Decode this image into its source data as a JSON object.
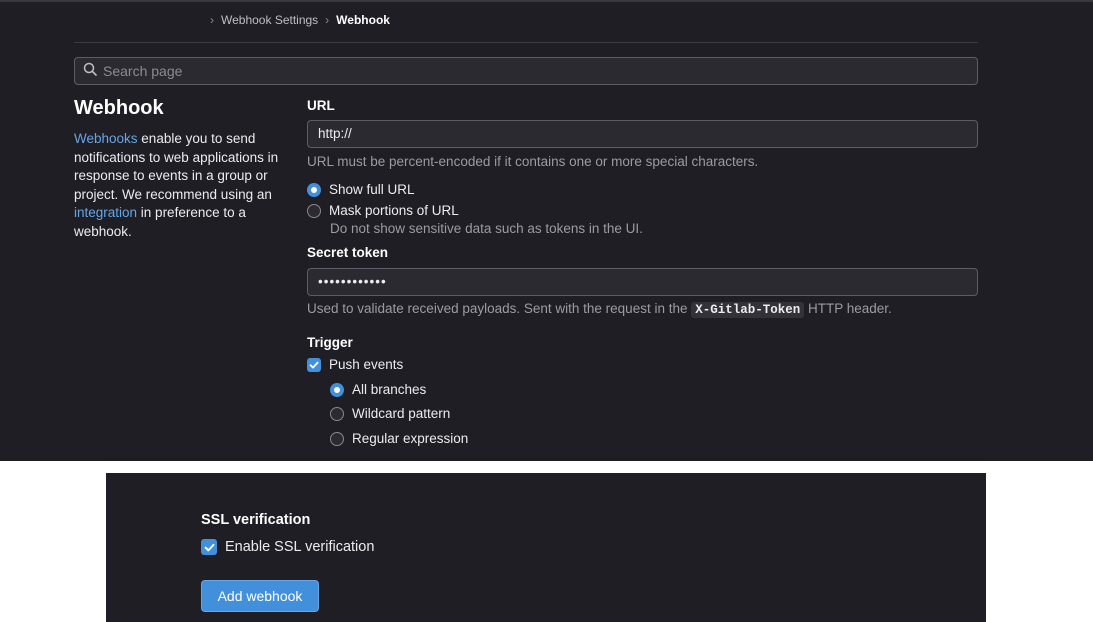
{
  "breadcrumb": {
    "separator": "›",
    "items": [
      "Webhook Settings",
      "Webhook"
    ]
  },
  "search": {
    "placeholder": "Search page"
  },
  "page": {
    "title": "Webhook",
    "description": {
      "link1": "Webhooks",
      "text1": " enable you to send notifications to web applications in response to events in a group or project. We recommend using an ",
      "link2": "integration",
      "text2": " in preference to a webhook."
    }
  },
  "url": {
    "label": "URL",
    "value": "http://",
    "help": "URL must be percent-encoded if it contains one or more special characters.",
    "options": [
      {
        "label": "Show full URL",
        "selected": true
      },
      {
        "label": "Mask portions of URL",
        "selected": false
      }
    ],
    "mask_help": "Do not show sensitive data such as tokens in the UI."
  },
  "secret": {
    "label": "Secret token",
    "value": "••••••••••••",
    "help_pre": "Used to validate received payloads. Sent with the request in the ",
    "help_code": "X-Gitlab-Token",
    "help_post": " HTTP header."
  },
  "trigger": {
    "label": "Trigger",
    "push_events": {
      "label": "Push events",
      "checked": true
    },
    "branch_options": [
      {
        "label": "All branches",
        "selected": true
      },
      {
        "label": "Wildcard pattern",
        "selected": false
      },
      {
        "label": "Regular expression",
        "selected": false
      }
    ]
  },
  "ssl": {
    "label": "SSL verification",
    "checkbox_label": "Enable SSL verification",
    "checked": true
  },
  "submit": {
    "label": "Add webhook"
  },
  "colors": {
    "background": "#1f1e24",
    "accent": "#428fdc",
    "link": "#63a6e9"
  }
}
